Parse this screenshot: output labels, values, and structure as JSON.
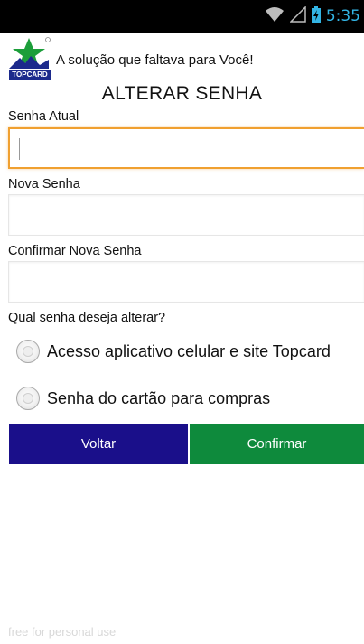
{
  "status_bar": {
    "time": "5:35",
    "icons": [
      "wifi-icon",
      "signal-icon",
      "battery-charging-icon"
    ],
    "time_color": "#33b5e5"
  },
  "header": {
    "logo_text": "TOPCARD",
    "tagline": "A solução que faltava para Você!"
  },
  "title": "ALTERAR SENHA",
  "fields": [
    {
      "label": "Senha Atual",
      "value": "",
      "focused": true
    },
    {
      "label": "Nova Senha",
      "value": "",
      "focused": false
    },
    {
      "label": "Confirmar Nova Senha",
      "value": "",
      "focused": false
    }
  ],
  "question": "Qual senha deseja alterar?",
  "options": [
    {
      "label": "Acesso aplicativo celular e site Topcard",
      "selected": false
    },
    {
      "label": "Senha do cartão para compras",
      "selected": false
    }
  ],
  "buttons": {
    "back": "Voltar",
    "confirm": "Confirmar"
  },
  "colors": {
    "back_button": "#1a0f8a",
    "confirm_button": "#0e8a3c",
    "focus_border": "#f0a030"
  },
  "watermark": "free for personal use"
}
